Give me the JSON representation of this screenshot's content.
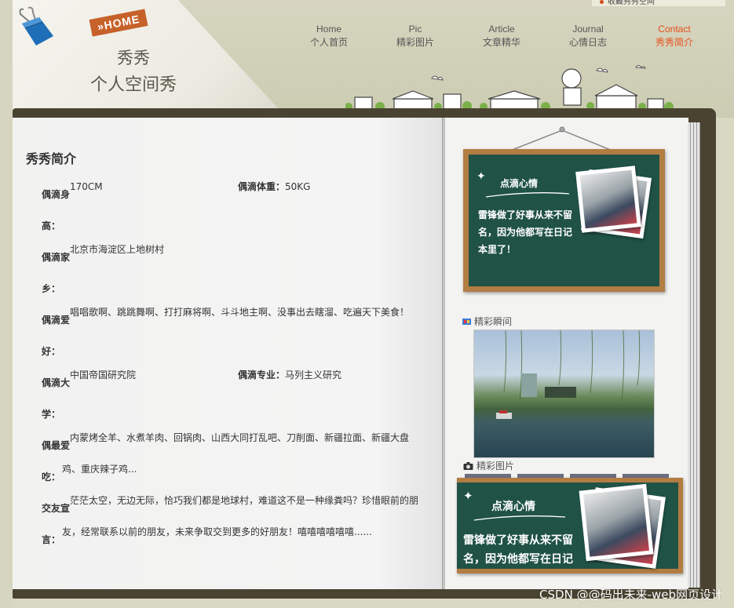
{
  "header": {
    "home_tag": "»HOME",
    "logo_line1": "秀秀",
    "logo_line2": "个人空间秀",
    "subscribe_label": "收藏秀秀空间"
  },
  "nav": [
    {
      "en": "Home",
      "cn": "个人首页",
      "active": false
    },
    {
      "en": "Pic",
      "cn": "精彩图片",
      "active": false
    },
    {
      "en": "Article",
      "cn": "文章精华",
      "active": false
    },
    {
      "en": "Journal",
      "cn": "心情日志",
      "active": false
    },
    {
      "en": "Contact",
      "cn": "秀秀简介",
      "active": true
    }
  ],
  "colors": {
    "active_nav": "#e8501c",
    "chalkboard": "#205246",
    "frame": "#b27d42",
    "book": "#4a4331"
  },
  "profile": {
    "title": "秀秀简介",
    "height_label_a": "偶滴身",
    "height_label_b": "高：",
    "height_value": "170CM",
    "weight_label": "偶滴体重：",
    "weight_value": "50KG",
    "home_label_a": "偶滴家",
    "home_label_b": "乡：",
    "home_value": "北京市海淀区上地树村",
    "hobby_label_a": "偶滴爱",
    "hobby_label_b": "好：",
    "hobby_value": "唱唱歌啊、跳跳舞啊、打打麻将啊、斗斗地主啊、没事出去瞎溜、吃遍天下美食！",
    "school_label_a": "偶滴大",
    "school_label_b": "学：",
    "school_value": "中国帝国研究院",
    "major_label": "偶滴专业：",
    "major_value": "马列主义研究",
    "food_label_a": "偶最爱",
    "food_label_b": "吃：",
    "food_value_1": "内蒙烤全羊、水煮羊肉、回锅肉、山西大同打乱吧、刀削面、新疆拉面、新疆大盘",
    "food_value_2": "鸡、重庆辣子鸡...",
    "friend_label_a": "交友宣",
    "friend_label_b": "言：",
    "friend_value_1": "茫茫太空，无边无际，恰巧我们都是地球村，难道这不是一种缘粪吗？珍惜眼前的朋",
    "friend_value_2": "友，经常联系以前的朋友，未来争取交到更多的好朋友！嘻嘻嘻嘻嘻嘻......"
  },
  "sidebar": {
    "board_title": "点滴心情",
    "board_text": "雷锋做了好事从来不留名，因为他都写在日记本里了！",
    "moments_title": "精彩瞬间",
    "pictures_title": "精彩图片"
  },
  "watermark": "CSDN @@码出未来-web网页设计"
}
